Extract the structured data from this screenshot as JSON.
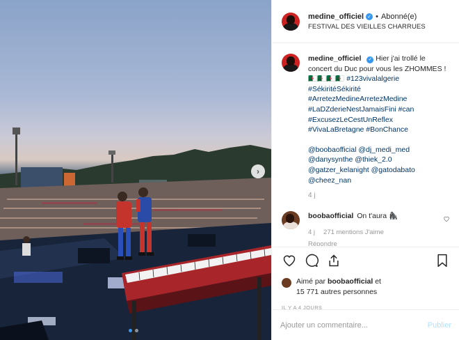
{
  "post": {
    "author": {
      "username": "medine_officiel",
      "follow_state": "Abonné(e)",
      "separator": "•"
    },
    "location": "FESTIVAL DES VIEILLES CHARRUES",
    "caption": {
      "username": "medine_officiel",
      "text_plain": "Hier j'ai trollé le concert du Duc pour vous les ZHOMMES ! 🇩🇿🇩🇿🇩🇿🇩🇿 ",
      "hashtags": "#123vivalalgerie\n#SékiritéSékirité\n#ArretezMedineArretezMedine\n#LaDZderieNestJamaisFini #can\n#ExcusezLeCestUnReflex\n#VivaLaBretagne #BonChance",
      "mentions": "@boobaofficial @dj_medi_med\n@danysynthe @thiek_2.0\n@gatzer_kelanight @gatodabato\n@cheez_nan",
      "time": "4 j"
    },
    "reply": {
      "username": "boobaofficial",
      "text": "On t'aura 🦍",
      "time": "4 j",
      "likes": "271 mentions J'aime",
      "reply_label": "Répondre"
    },
    "likes": {
      "prefix": "Aimé par",
      "user": "boobaofficial",
      "conjunction": "et",
      "others": "15 771 autres personnes"
    },
    "date": "IL Y A 4 JOURS",
    "comment_box": {
      "placeholder": "Ajouter un commentaire...",
      "publish_label": "Publier"
    },
    "icons": [
      "heart-icon",
      "comment-icon",
      "share-icon",
      "bookmark-icon",
      "next-arrow-icon",
      "verified-badge-icon"
    ],
    "carousel": {
      "slides": 2,
      "active_index": 0
    },
    "colors": {
      "accent": "#3897f0",
      "hashtag": "#003569",
      "muted": "#999999",
      "publish": "#b2dffc"
    }
  }
}
